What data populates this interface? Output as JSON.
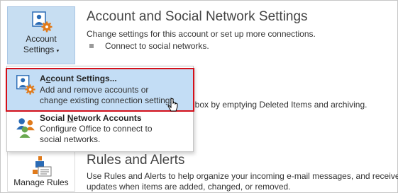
{
  "account_section": {
    "button_line1": "Account",
    "button_line2": "Settings",
    "title": "Account and Social Network Settings",
    "description": "Change settings for this account or set up more connections.",
    "bullet_item": "Connect to social networks."
  },
  "menu": {
    "items": [
      {
        "title_pre": "A",
        "title_underlined": "c",
        "title_post": "count Settings...",
        "desc_line1": "Add and remove accounts or",
        "desc_line2": "change existing connection settings."
      },
      {
        "title_pre": "Social ",
        "title_underlined": "N",
        "title_post": "etwork Accounts",
        "desc_line1": "Configure Office to connect to",
        "desc_line2": "social networks."
      }
    ]
  },
  "cleanup_partial_text": "lbox by emptying Deleted Items and archiving.",
  "rules_section": {
    "button_label": "Manage Rules",
    "title": "Rules and Alerts",
    "desc_line1": "Use Rules and Alerts to help organize your incoming e-mail messages, and receive",
    "desc_line2": "updates when items are added, changed, or removed."
  },
  "colors": {
    "selected_bg": "#c3ddf5",
    "highlight_border": "#d4101a",
    "gear": "#e07a1b",
    "person": "#2a6bb5"
  }
}
